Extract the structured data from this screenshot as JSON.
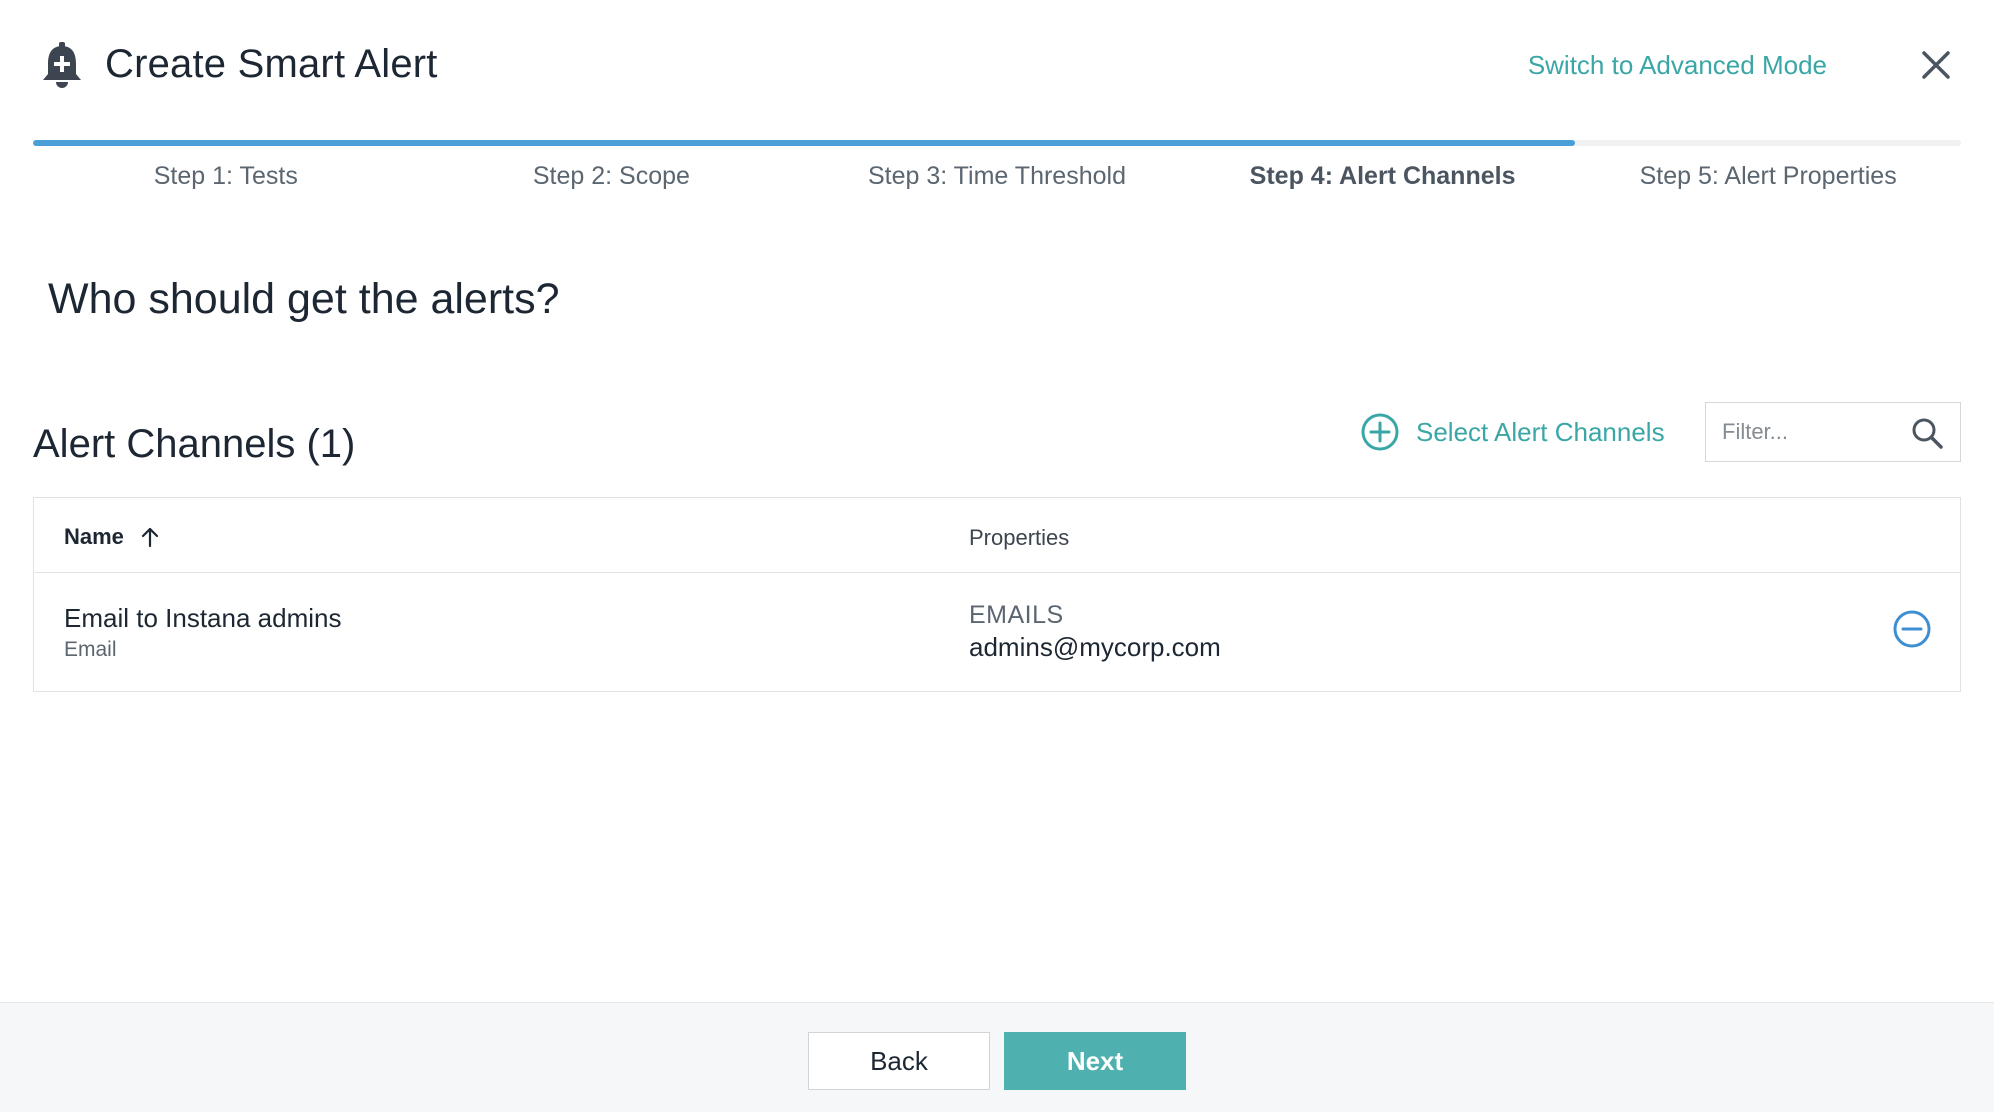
{
  "header": {
    "icon": "bell-plus-icon",
    "title": "Create Smart Alert",
    "advanced_mode_link": "Switch to Advanced Mode",
    "close_icon": "close-icon"
  },
  "stepper": {
    "progress": 0.8,
    "steps": [
      {
        "label": "Step 1: Tests",
        "active": false
      },
      {
        "label": "Step 2: Scope",
        "active": false
      },
      {
        "label": "Step 3: Time Threshold",
        "active": false
      },
      {
        "label": "Step 4: Alert Channels",
        "active": true
      },
      {
        "label": "Step 5: Alert Properties",
        "active": false
      }
    ]
  },
  "main": {
    "question": "Who should get the alerts?",
    "channels_title": "Alert Channels (1)",
    "select_channels_label": "Select Alert Channels",
    "filter": {
      "placeholder": "Filter...",
      "value": ""
    }
  },
  "table": {
    "columns": {
      "name": "Name",
      "properties": "Properties"
    },
    "sort": "ascending",
    "rows": [
      {
        "name": "Email to Instana admins",
        "type": "Email",
        "property_label": "EMAILS",
        "property_value": "admins@mycorp.com"
      }
    ]
  },
  "footer": {
    "back_label": "Back",
    "next_label": "Next"
  },
  "colors": {
    "accent": "#3ba6a6",
    "progress": "#4a9fd8",
    "next_button": "#4fb1af",
    "remove_icon": "#3d8fd1"
  }
}
